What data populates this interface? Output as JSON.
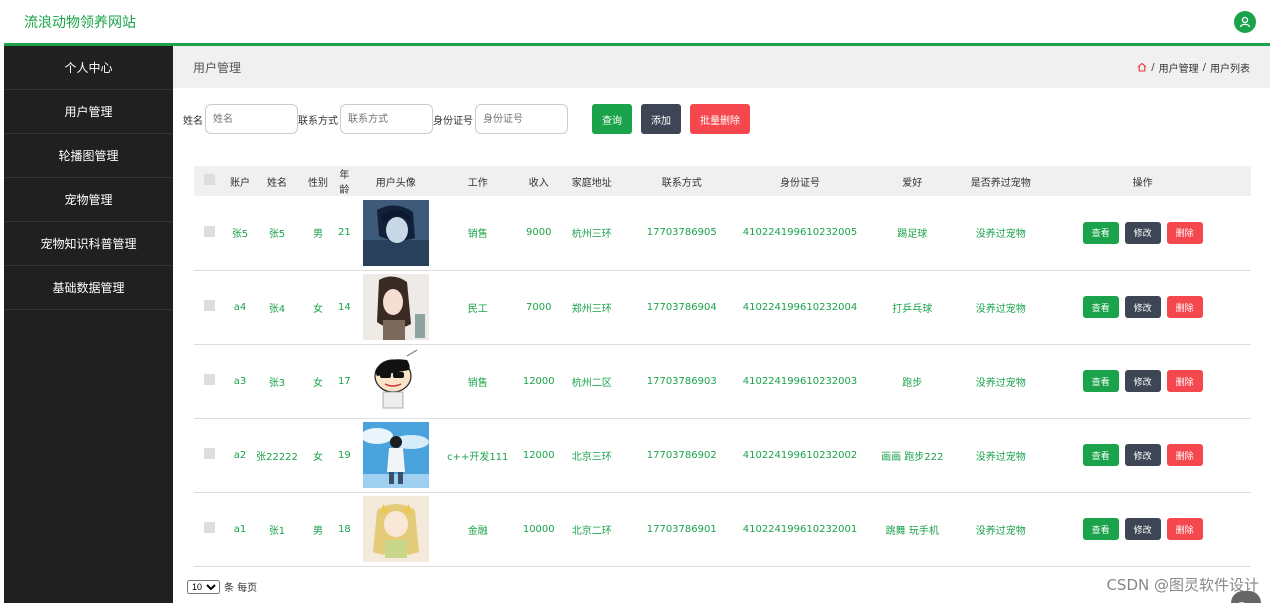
{
  "header": {
    "site_title": "流浪动物领养网站"
  },
  "sidebar": {
    "items": [
      {
        "label": "个人中心"
      },
      {
        "label": "用户管理"
      },
      {
        "label": "轮播图管理"
      },
      {
        "label": "宠物管理"
      },
      {
        "label": "宠物知识科普管理"
      },
      {
        "label": "基础数据管理"
      }
    ]
  },
  "breadcrumb": {
    "title": "用户管理",
    "path1": "用户管理",
    "path2": "用户列表",
    "sep": "/"
  },
  "search": {
    "name_label": "姓名",
    "name_placeholder": "姓名",
    "phone_label": "联系方式",
    "phone_placeholder": "联系方式",
    "id_label": "身份证号",
    "id_placeholder": "身份证号",
    "query_label": "查询",
    "add_label": "添加",
    "batch_delete_label": "批量删除"
  },
  "table": {
    "headers": [
      "",
      "账户",
      "姓名",
      "性别",
      "年龄",
      "用户头像",
      "工作",
      "收入",
      "家庭地址",
      "联系方式",
      "身份证号",
      "爱好",
      "是否养过宠物",
      "操作"
    ],
    "rows": [
      {
        "account": "张5",
        "name": "张5",
        "gender": "男",
        "age": "21",
        "job": "销售",
        "income": "9000",
        "address": "杭州三环",
        "phone": "17703786905",
        "idno": "410224199610232005",
        "hobby": "踢足球",
        "pet": "没养过宠物",
        "avatar": "anime-boy"
      },
      {
        "account": "a4",
        "name": "张4",
        "gender": "女",
        "age": "14",
        "job": "民工",
        "income": "7000",
        "address": "郑州三环",
        "phone": "17703786904",
        "idno": "410224199610232004",
        "hobby": "打乒乓球",
        "pet": "没养过宠物",
        "avatar": "anime-girl"
      },
      {
        "account": "a3",
        "name": "张3",
        "gender": "女",
        "age": "17",
        "job": "销售",
        "income": "12000",
        "address": "杭州二区",
        "phone": "17703786903",
        "idno": "410224199610232003",
        "hobby": "跑步",
        "pet": "没养过宠物",
        "avatar": "cartoon-kid"
      },
      {
        "account": "a2",
        "name": "张22222",
        "gender": "女",
        "age": "19",
        "job": "c++开发111",
        "income": "12000",
        "address": "北京三环",
        "phone": "17703786902",
        "idno": "410224199610232002",
        "hobby": "画画 跑步222",
        "pet": "没养过宠物",
        "avatar": "boy-sky"
      },
      {
        "account": "a1",
        "name": "张1",
        "gender": "男",
        "age": "18",
        "job": "金融",
        "income": "10000",
        "address": "北京二环",
        "phone": "17703786901",
        "idno": "410224199610232001",
        "hobby": "跳舞 玩手机",
        "pet": "没养过宠物",
        "avatar": "blonde-girl"
      }
    ],
    "actions": {
      "view": "查看",
      "edit": "修改",
      "delete": "删除"
    }
  },
  "pager": {
    "page_size": "10",
    "suffix": "条 每页"
  },
  "watermark": "CSDN @图灵软件设计",
  "top_button": "Top",
  "colors": {
    "accent": "#1aa34a",
    "sidebar": "#202020",
    "dark_button": "#3e4554",
    "danger": "#f5474e"
  }
}
